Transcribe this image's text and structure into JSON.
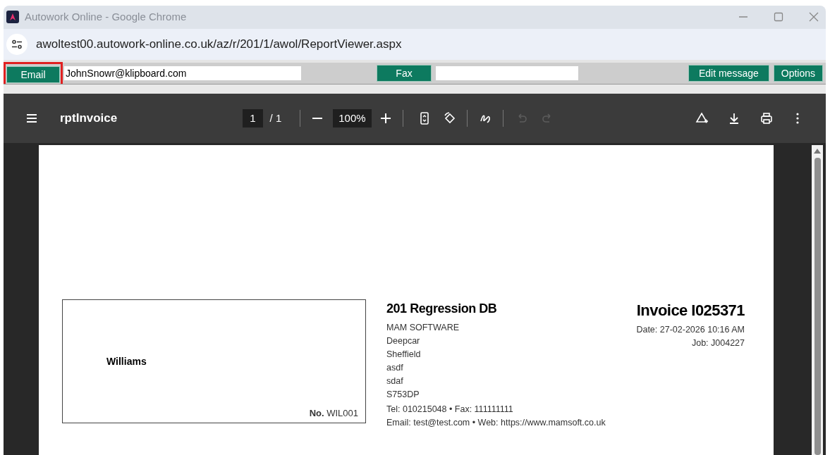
{
  "window": {
    "title": "Autowork Online - Google Chrome"
  },
  "address_bar": {
    "url": "awoltest00.autowork-online.co.uk/az/r/201/1/awol/ReportViewer.aspx"
  },
  "send_bar": {
    "email": {
      "label": "Email",
      "value": "JohnSnowr@klipboard.com",
      "highlighted": true
    },
    "fax": {
      "label": "Fax"
    },
    "actions": [
      "Edit message",
      "Options"
    ]
  },
  "pdf_toolbar": {
    "title": "rptInvoice",
    "page": "1",
    "page_total": "/ 1",
    "zoom": "100%",
    "tools": [
      {
        "kind": "fit",
        "disabled": false
      },
      {
        "kind": "rotate",
        "disabled": false
      },
      {
        "kind": "draw",
        "disabled": false
      },
      {
        "kind": "undo",
        "disabled": true
      },
      {
        "kind": "redo",
        "disabled": true
      }
    ]
  },
  "document": {
    "recipient": {
      "name": "Williams",
      "account": "**No.** WIL001"
    },
    "company": {
      "name": "201 Regression DB",
      "address_lines": [
        "MAM SOFTWARE",
        "Deepcar",
        "Sheffield",
        "asdf",
        "sdaf",
        "S753DP"
      ],
      "contact_lines": [
        "Tel: 010215048 • Fax: 111111111",
        "Email: test@test.com • Web: https://www.mamsoft.co.uk"
      ]
    },
    "invoice": {
      "title": "Invoice I025371",
      "date": "Date: 27-02-2026 10:16 AM",
      "job": "Job: J004227"
    }
  }
}
